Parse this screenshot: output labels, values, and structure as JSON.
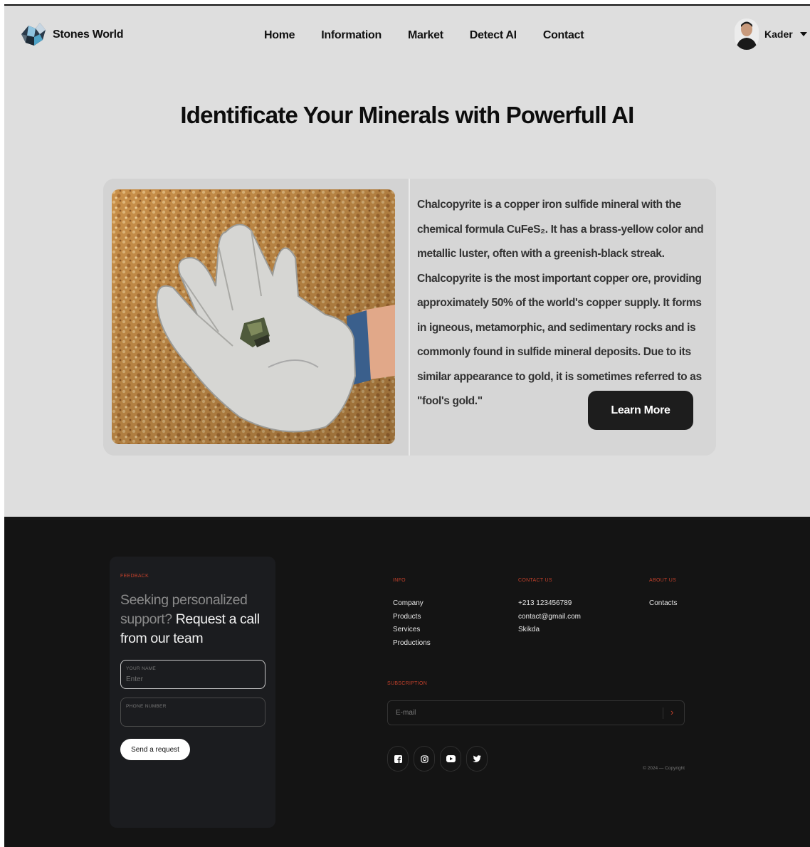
{
  "header": {
    "brand": "Stones World",
    "nav": [
      "Home",
      "Information",
      "Market",
      "Detect AI",
      "Contact"
    ],
    "user_name": "Kader"
  },
  "hero": {
    "title": "Identificate Your Minerals with Powerfull AI"
  },
  "card": {
    "description": "Chalcopyrite is a copper iron sulfide mineral with the chemical formula CuFeS₂. It has a brass-yellow color and metallic luster, often with a greenish-black streak. Chalcopyrite is the most important copper ore, providing approximately 50% of the world's copper supply. It forms in igneous, metamorphic, and sedimentary rocks and is commonly found in sulfide mineral deposits. Due to its similar appearance to gold, it is sometimes referred to as \"fool's gold.\"",
    "button": "Learn More"
  },
  "footer": {
    "feedback": {
      "label": "FEEDBACK",
      "heading_muted": "Seeking personalized support?",
      "heading_bright": "Request a call from our team",
      "name_label": "YOUR NAME",
      "name_placeholder": "Enter",
      "phone_label": "PHONE NUMBER",
      "submit": "Send a request"
    },
    "info": {
      "title": "INFO",
      "items": [
        "Company",
        "Products",
        "Services",
        "Productions"
      ]
    },
    "contact": {
      "title": "CONTACT US",
      "items": [
        "+213 123456789",
        "contact@gmail.com",
        "Skikda"
      ]
    },
    "about": {
      "title": "ABOUT US",
      "items": [
        "Contacts"
      ]
    },
    "subscription": {
      "title": "SUBSCRIPTION",
      "placeholder": "E-mail"
    },
    "socials": [
      "facebook-icon",
      "instagram-icon",
      "youtube-icon",
      "twitter-icon"
    ],
    "copyright": "© 2024 — Copyright"
  },
  "colors": {
    "page_bg": "#dedede",
    "footer_bg": "#141414",
    "accent": "#c0402b",
    "button_dark": "#1d1d1d"
  }
}
